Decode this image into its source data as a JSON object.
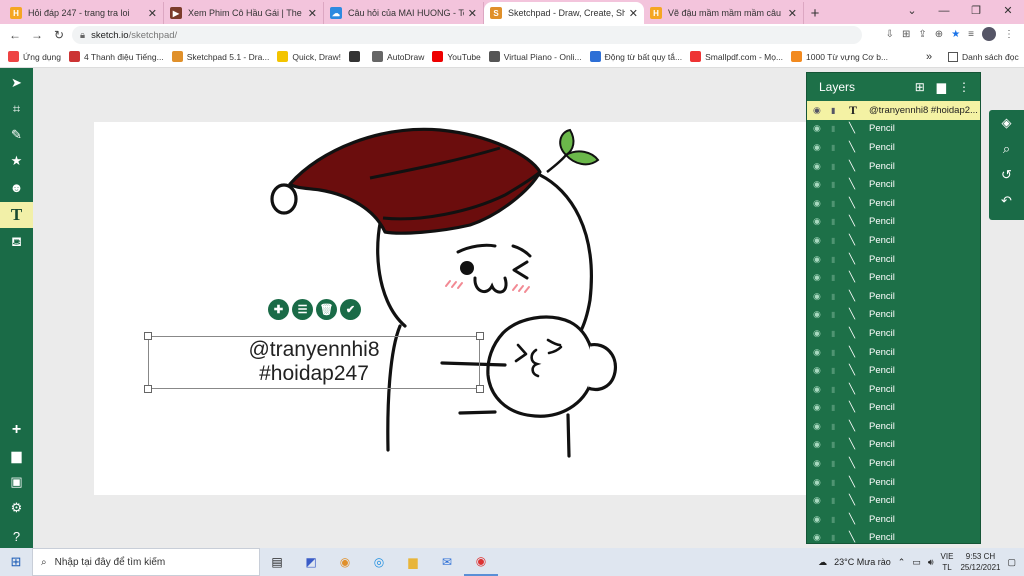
{
  "browser": {
    "tabs": [
      {
        "title": "Hỏi đáp 247 - trang tra loi",
        "favicon": "H",
        "color": "#f5a623"
      },
      {
        "title": "Xem Phim Cô Hầu Gái | The Hand",
        "favicon": "▶",
        "color": "#7b3b2b"
      },
      {
        "title": "Câu hỏi của MAI HUONG - Toán",
        "favicon": "☁",
        "color": "#2d8ae0"
      },
      {
        "title": "Sketchpad - Draw, Create, Share!",
        "favicon": "S",
        "color": "#e0902a"
      },
      {
        "title": "Vẽ đậu mầm mầm mầm câu hỏi",
        "favicon": "H",
        "color": "#f5a623"
      }
    ],
    "active_tab_index": 3,
    "close_symbol": "✕",
    "new_tab": "+",
    "window_controls": [
      "⌄",
      "—",
      "❐",
      "✕"
    ],
    "url_domain": "sketch.io",
    "url_path": "/sketchpad/",
    "bookmarks": [
      {
        "label": "Ứng dụng",
        "color": "#e44"
      },
      {
        "label": "4 Thanh điệu Tiếng...",
        "color": "#c33"
      },
      {
        "label": "Sketchpad 5.1 - Dra...",
        "color": "#e0902a"
      },
      {
        "label": "Quick, Draw!",
        "color": "#f3c400"
      },
      {
        "label": "",
        "color": "#333"
      },
      {
        "label": "AutoDraw",
        "color": "#666"
      },
      {
        "label": "YouTube",
        "color": "#e00"
      },
      {
        "label": "Virtual Piano - Onli...",
        "color": "#555"
      },
      {
        "label": "Động từ bất quy tắ...",
        "color": "#2d6fd6"
      },
      {
        "label": "Smallpdf.com - Mọ...",
        "color": "#e33"
      },
      {
        "label": "1000 Từ vựng Cơ b...",
        "color": "#f28a1f"
      }
    ],
    "bookmarks_more": "»",
    "reading_list": "Danh sách đọc"
  },
  "sketchpad": {
    "text_content": [
      "@tranyennhi8",
      "#hoidap247"
    ],
    "layers_title": "Layers",
    "layers": [
      {
        "name": "@tranyennhi8 #hoidap2...",
        "type": "T",
        "selected": true
      },
      {
        "name": "Pencil",
        "type": "pencil"
      },
      {
        "name": "Pencil",
        "type": "pencil"
      },
      {
        "name": "Pencil",
        "type": "pencil"
      },
      {
        "name": "Pencil",
        "type": "pencil"
      },
      {
        "name": "Pencil",
        "type": "pencil"
      },
      {
        "name": "Pencil",
        "type": "pencil"
      },
      {
        "name": "Pencil",
        "type": "pencil"
      },
      {
        "name": "Pencil",
        "type": "pencil"
      },
      {
        "name": "Pencil",
        "type": "pencil"
      },
      {
        "name": "Pencil",
        "type": "pencil"
      },
      {
        "name": "Pencil",
        "type": "pencil"
      },
      {
        "name": "Pencil",
        "type": "pencil"
      },
      {
        "name": "Pencil",
        "type": "pencil"
      },
      {
        "name": "Pencil",
        "type": "pencil"
      },
      {
        "name": "Pencil",
        "type": "pencil"
      },
      {
        "name": "Pencil",
        "type": "pencil"
      },
      {
        "name": "Pencil",
        "type": "pencil"
      },
      {
        "name": "Pencil",
        "type": "pencil"
      },
      {
        "name": "Pencil",
        "type": "pencil"
      },
      {
        "name": "Pencil",
        "type": "pencil"
      },
      {
        "name": "Pencil",
        "type": "pencil"
      },
      {
        "name": "Pencil",
        "type": "pencil"
      },
      {
        "name": "Pencil",
        "type": "pencil"
      }
    ],
    "accent_color": "#1a6b47",
    "selected_color": "#f4f2a4"
  },
  "taskbar": {
    "search_placeholder": "Nhập tại đây để tìm kiếm",
    "weather": "23°C  Mưa rào",
    "language_1": "VIE",
    "language_2": "TL",
    "time": "9:53 CH",
    "date": "25/12/2021"
  }
}
